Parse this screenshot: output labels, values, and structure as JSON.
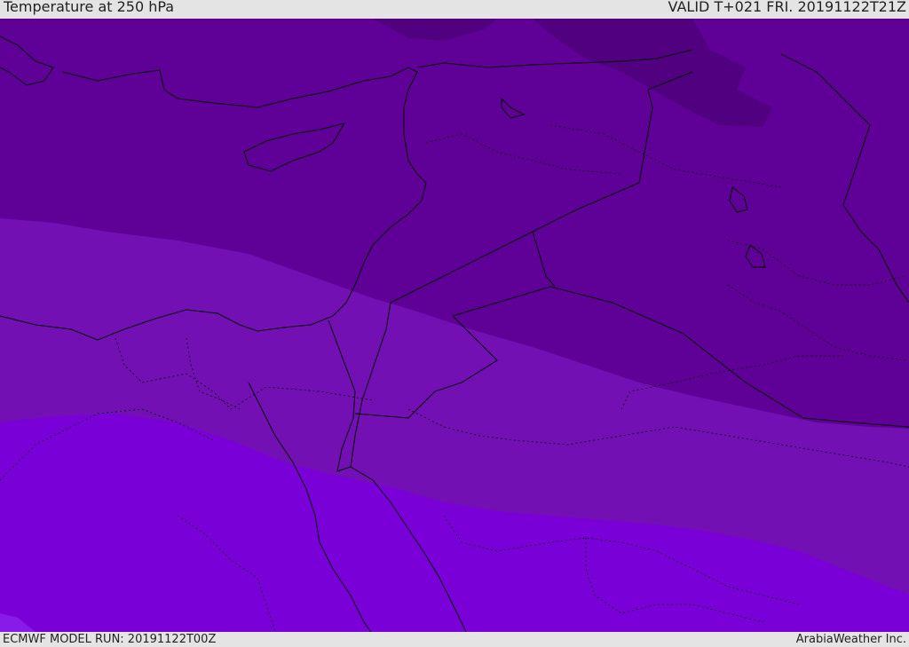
{
  "header": {
    "title": "Temperature at 250 hPa",
    "valid_time": "VALID T+021 FRI. 20191122T21Z"
  },
  "footer": {
    "model_run": "ECMWF MODEL RUN: 20191122T00Z",
    "credit": "ArabiaWeather Inc."
  },
  "colors": {
    "band_cold": "#5f0097",
    "band_coldest": "#51007f",
    "band_mid": "#7210b4",
    "band_warm": "#7a00d8",
    "band_warmest": "#8a1ae8",
    "coastline": "#000000",
    "border": "#1a0030"
  }
}
